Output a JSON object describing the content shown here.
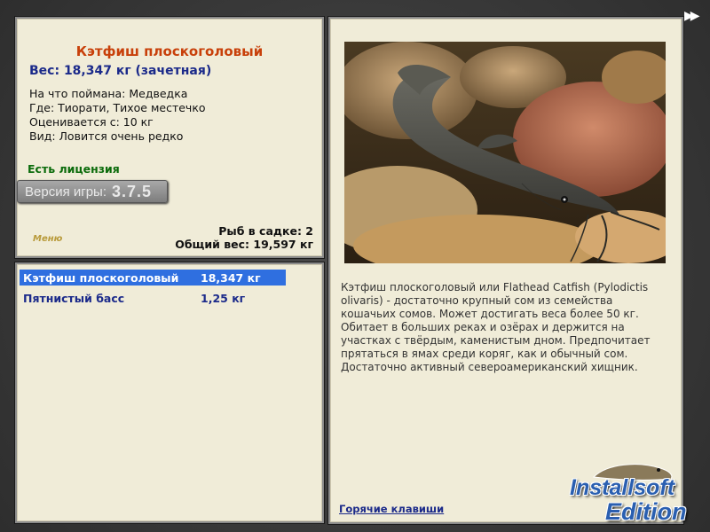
{
  "info": {
    "title": "Кэтфиш плоскоголовый",
    "weight_line": "Вес: 18,347 кг (зачетная)",
    "caught_with": "На что поймана: Медведка",
    "location": "Где: Тиорати, Тихое местечко",
    "rated_from": "Оценивается с: 10 кг",
    "rarity": "Вид: Ловится очень редко",
    "license": "Есть лицензия",
    "version_label": "Версия игры:",
    "version_number": "3.7.5",
    "menu_label": "Меню",
    "fish_in_keepnet": "Рыб в садке: 2",
    "total_weight": "Общий вес: 19,597 кг"
  },
  "list": {
    "rows": [
      {
        "name": "Кэтфиш плоскоголовый",
        "weight": "18,347 кг",
        "selected": true
      },
      {
        "name": "Пятнистый басс",
        "weight": "1,25 кг",
        "selected": false
      }
    ]
  },
  "detail": {
    "description": "Кэтфиш плоскоголовый или Flathead Catfish (Pylodictis olivaris) - достаточно крупный сом из семейства кошачьих сомов. Может достигать веса более 50 кг. Обитает в больших реках и озёрах и держится на участках с твёрдым, каменистым дном. Предпочитает прятаться в ямах среди коряг, как и обычный сом. Достаточно активный североамериканский хищник.",
    "hotkeys": "Горячие клавиши"
  },
  "logo": {
    "line1": "Installsoft",
    "line2": "Edition"
  },
  "icons": {
    "fast_forward": "fast-forward-icon"
  },
  "colors": {
    "title": "#c8400a",
    "accent_blue": "#1b2a8a",
    "license_green": "#0a6b0a",
    "selection": "#2f6fe0"
  }
}
